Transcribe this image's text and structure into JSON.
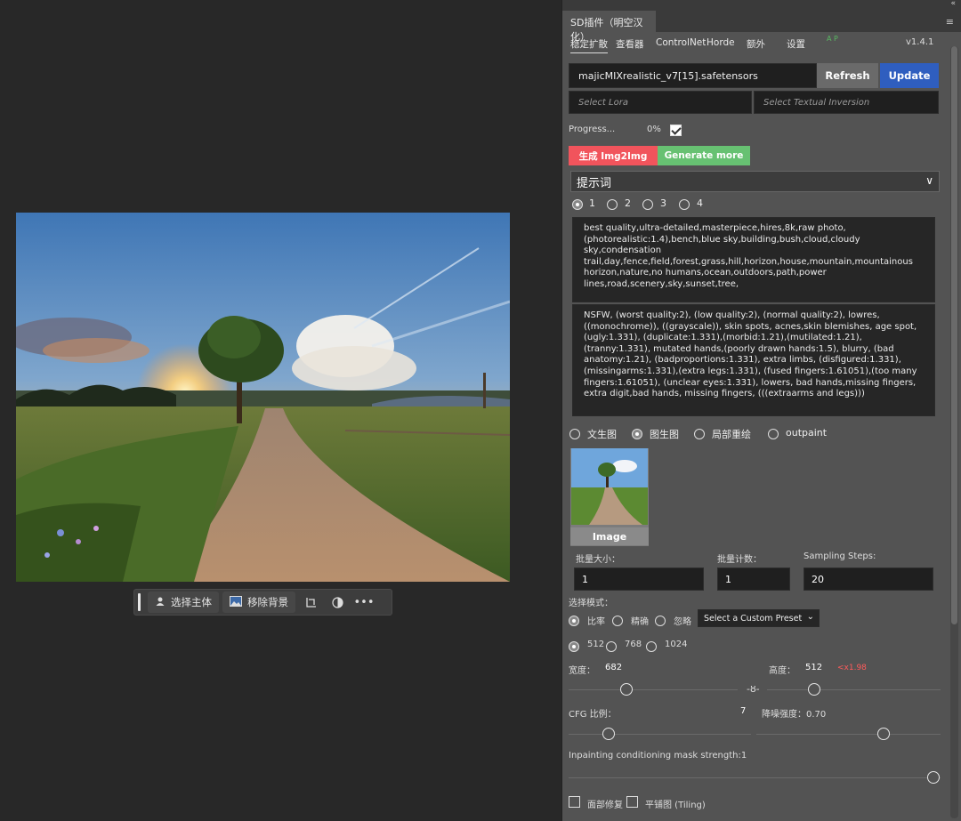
{
  "canvas": {
    "toolbar": {
      "select_subject_label": "选择主体",
      "remove_bg_label": "移除背景",
      "icons": [
        "person-icon",
        "image-icon",
        "crop-transform-icon",
        "contrast-icon",
        "more-icon"
      ]
    }
  },
  "panel": {
    "collapse_glyph": "«",
    "tab_title": "SD插件（明空汉化）",
    "menu_glyph": "≡",
    "subtabs": [
      "稳定扩散",
      "查看器",
      "ControlNet",
      "Horde",
      "额外",
      "设置"
    ],
    "ap_label": "A P",
    "version": "v1.4.1",
    "model": {
      "value": "majicMIXrealistic_v7[15].safetensors",
      "refresh_label": "Refresh",
      "update_label": "Update"
    },
    "lora_placeholder": "Select Lora",
    "textual_inversion_placeholder": "Select Textual Inversion",
    "progress": {
      "label": "Progress...",
      "value": "0%",
      "fraction": 0,
      "checked": true
    },
    "generate_label": "生成 Img2Img",
    "generate_more_label": "Generate more",
    "prompt_section_label": "提示词",
    "prompt_tabs": [
      "1",
      "2",
      "3",
      "4"
    ],
    "prompt_tab_selected": "1",
    "positive_prompt": "best quality,ultra-detailed,masterpiece,hires,8k,raw photo,(photorealistic:1.4),bench,blue sky,building,bush,cloud,cloudy sky,condensation trail,day,fence,field,forest,grass,hill,horizon,house,mountain,mountainous horizon,nature,no humans,ocean,outdoors,path,power lines,road,scenery,sky,sunset,tree,",
    "negative_prompt": "NSFW, (worst quality:2), (low quality:2), (normal quality:2), lowres, ((monochrome)), ((grayscale)), skin spots, acnes,skin blemishes, age spot, (ugly:1.331), (duplicate:1.331),(morbid:1.21),(mutilated:1.21), (tranny:1.331), mutated hands,(poorly drawn hands:1.5), blurry, (bad anatomy:1.21), (badproportions:1.331), extra limbs, (disfigured:1.331), (missingarms:1.331),(extra legs:1.331), (fused fingers:1.61051),(too many fingers:1.61051), (unclear eyes:1.331), lowers, bad hands,missing fingers, extra digit,bad hands, missing fingers, (((extraarms and legs)))",
    "modes": [
      "文生图",
      "图生图",
      "局部重绘",
      "outpaint"
    ],
    "mode_selected": "图生图",
    "image_caption": "Image",
    "batch_size": {
      "label": "批量大小：",
      "value": "1"
    },
    "batch_count": {
      "label": "批量计数：",
      "value": "1"
    },
    "sampling_steps": {
      "label": "Sampling Steps:",
      "value": "20"
    },
    "select_mode_label": "选择模式：",
    "ratio_options": [
      "比率",
      "精确",
      "忽略"
    ],
    "ratio_selected": "比率",
    "preset_label": "Select a Custom Preset",
    "size_options": [
      "512",
      "768",
      "1024"
    ],
    "size_selected": "512",
    "width": {
      "label": "宽度：",
      "value": "682"
    },
    "height": {
      "label": "高度：",
      "value": "512",
      "scale": "<x1.98"
    },
    "cfg": {
      "label": "CFG 比例：",
      "value": "7"
    },
    "denoise": {
      "label": "降噪强度：0.70"
    },
    "inpaint_mask_label": "Inpainting conditioning mask strength:1",
    "face_restore_label": "面部修复",
    "tiling_label": "平铺图 (Tiling)"
  },
  "colors": {
    "generate": "#f1545c",
    "generate_more": "#67c172",
    "update": "#2f5ebf",
    "refresh": "#6a6a6a"
  }
}
